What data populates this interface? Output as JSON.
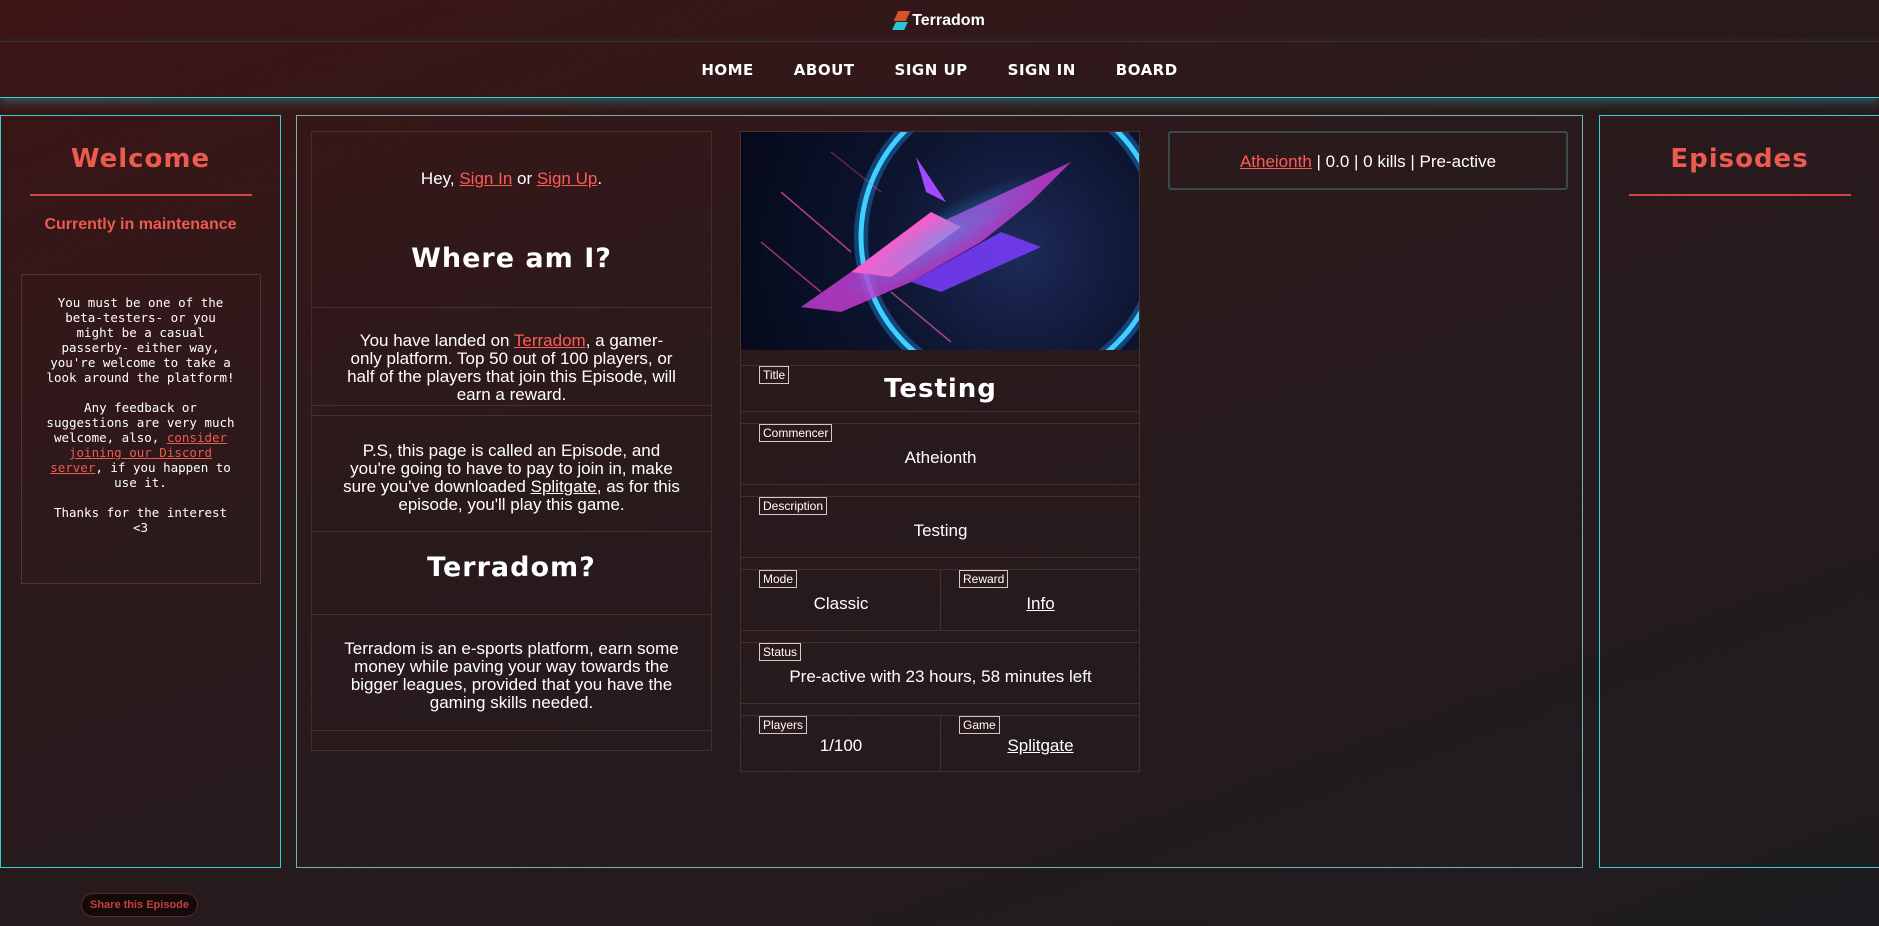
{
  "brand": {
    "name": "Terradom"
  },
  "nav": {
    "items": [
      "HOME",
      "ABOUT",
      "SIGN UP",
      "SIGN IN",
      "BOARD"
    ]
  },
  "left_panel": {
    "title": "Welcome",
    "maintenance": "Currently in maintenance",
    "note": {
      "p1": "You must be one of the beta-testers- or you might be a casual passerby- either way, you're welcome to take a look around the platform!",
      "p2_before": "Any feedback or suggestions are very much welcome, also,",
      "p2_link": "consider joining our Discord server",
      "p2_after": ", if you happen to use it.",
      "p3": "Thanks for the interest <3"
    }
  },
  "right_panel": {
    "title": "Episodes"
  },
  "info": {
    "greet_prefix": "Hey, ",
    "sign_in": "Sign In",
    "greet_or": " or ",
    "sign_up": "Sign Up",
    "greet_suffix": ".",
    "where_title": "Where am I?",
    "landed_prefix": "You have landed on ",
    "landed_link": "Terradom",
    "landed_suffix": ", a gamer-only platform. Top 50 out of 100 players, or half of the players that join this Episode, will earn a reward.",
    "ps_prefix": "P.S, this page is called an Episode, and you're going to have to pay to join in, make sure you've downloaded ",
    "ps_link": "Splitgate",
    "ps_suffix": ", as for this episode, you'll play this game.",
    "terradom_title": "Terradom?",
    "terradom_text": "Terradom is an e-sports platform, earn some money while paving your way towards the bigger leagues, provided that you have the gaming skills needed."
  },
  "episode": {
    "title_label": "Title",
    "title": "Testing",
    "commencer_label": "Commencer",
    "commencer": "Atheionth",
    "description_label": "Description",
    "description": "Testing",
    "mode_label": "Mode",
    "mode": "Classic",
    "reward_label": "Reward",
    "reward": "Info",
    "status_label": "Status",
    "status": "Pre-active with 23 hours, 58 minutes left",
    "players_label": "Players",
    "players": "1/100",
    "game_label": "Game",
    "game": "Splitgate"
  },
  "stats": {
    "user": "Atheionth",
    "rest": " | 0.0 | 0 kills | Pre-active"
  },
  "share": {
    "label": "Share this Episode"
  },
  "colors": {
    "accent": "#ec5a50",
    "frame": "#34d0d6"
  }
}
